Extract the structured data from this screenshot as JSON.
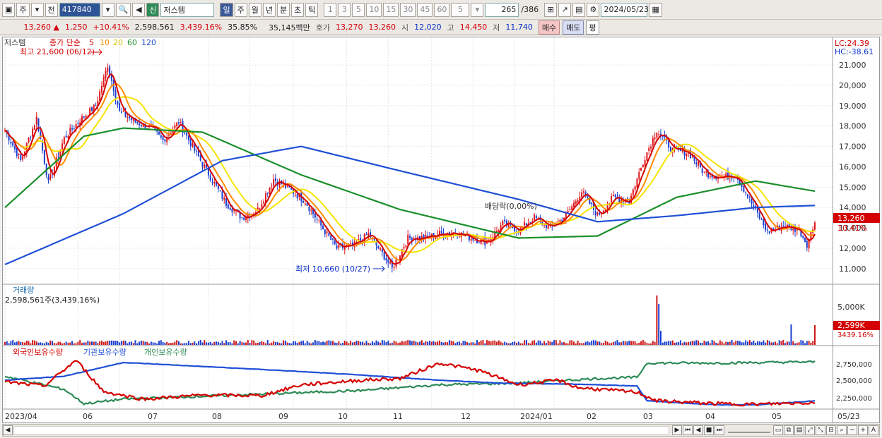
{
  "toolbar": {
    "period_main": "주",
    "prev_label": "전",
    "code": "417840",
    "name": "저스템",
    "credit_label": "신",
    "period_tabs": [
      "일",
      "주",
      "월",
      "년",
      "분",
      "초",
      "틱"
    ],
    "active_tab": 0,
    "intervals": [
      "1",
      "3",
      "5",
      "10",
      "15",
      "30",
      "45",
      "60"
    ],
    "interval_select": "5",
    "page_count": "265",
    "page_total": "/386",
    "date": "2024/05/23"
  },
  "quote": {
    "price": "13,260",
    "change": "1,250",
    "change_pct": "+10.41%",
    "volume": "2,598,561",
    "volume_ratio": "3,439.16%",
    "turnover": "35.85%",
    "amount": "35,145백만",
    "ask_label": "호가",
    "ask": "13,270",
    "bid": "13,260",
    "open_label": "시",
    "open": "12,020",
    "high_label": "고",
    "high": "14,450",
    "low_label": "저",
    "low": "11,740",
    "buy_label": "매수",
    "sell_label": "매도",
    "avg_label": "평"
  },
  "price_panel": {
    "legend_name": "저스템",
    "legend_ma": "종가 단순",
    "ma_labels": [
      "5",
      "10",
      "20",
      "60",
      "120"
    ],
    "ma_colors": [
      "#d40000",
      "#ff8c00",
      "#f5e400",
      "#1a8f2a",
      "#1f4fd6"
    ],
    "high_annot": "최고 21,600 (06/12)",
    "low_annot": "최저 10,660 (10/27)",
    "dividend_annot": "배당락(0.00%)",
    "lc": "LC:24.39",
    "hc": "HC:-38.61",
    "current_price": "13,260",
    "current_pct": "10.41%",
    "y_ticks": [
      "21,000",
      "20,000",
      "19,000",
      "18,000",
      "17,000",
      "16,000",
      "15,000",
      "14,000",
      "13,000",
      "12,000",
      "11,000"
    ]
  },
  "volume_panel": {
    "title": "거래량",
    "value": "2,598,561주(3,439.16%)",
    "y_tick": "5,000K",
    "current": "2,599K",
    "current_pct": "3439.16%"
  },
  "holding_panel": {
    "legend": [
      "외국인보유수량",
      "기관보유수량",
      "개인보유수량"
    ],
    "legend_colors": [
      "#d40000",
      "#1f4fd6",
      "#2e8b57"
    ],
    "y_ticks": [
      "2,750,000",
      "2,500,000",
      "2,250,000"
    ]
  },
  "x_axis": [
    "2023/04",
    "06",
    "07",
    "08",
    "09",
    "10",
    "11",
    "12",
    "2024/01",
    "02",
    "03",
    "04",
    "05"
  ],
  "x_axis_end": "05/23",
  "chart_data": {
    "type": "candlestick",
    "ylim": [
      10300,
      21800
    ],
    "months": [
      "2023/04",
      "06",
      "07",
      "08",
      "09",
      "10",
      "11",
      "12",
      "2024/01",
      "02",
      "03",
      "04",
      "05"
    ],
    "close_path": [
      [
        0,
        17800
      ],
      [
        8,
        16300
      ],
      [
        16,
        18400
      ],
      [
        22,
        15200
      ],
      [
        30,
        17400
      ],
      [
        38,
        18300
      ],
      [
        46,
        19000
      ],
      [
        52,
        21000
      ],
      [
        58,
        18700
      ],
      [
        66,
        18200
      ],
      [
        74,
        17900
      ],
      [
        80,
        17300
      ],
      [
        88,
        18200
      ],
      [
        96,
        16800
      ],
      [
        104,
        15500
      ],
      [
        112,
        14200
      ],
      [
        120,
        13500
      ],
      [
        128,
        13900
      ],
      [
        136,
        15400
      ],
      [
        144,
        14900
      ],
      [
        152,
        14300
      ],
      [
        160,
        13100
      ],
      [
        168,
        12000
      ],
      [
        176,
        12100
      ],
      [
        184,
        12700
      ],
      [
        192,
        11600
      ],
      [
        196,
        11000
      ],
      [
        204,
        12500
      ],
      [
        212,
        12500
      ],
      [
        220,
        12700
      ],
      [
        228,
        12800
      ],
      [
        236,
        12500
      ],
      [
        244,
        12300
      ],
      [
        252,
        13200
      ],
      [
        260,
        12900
      ],
      [
        268,
        13500
      ],
      [
        276,
        13000
      ],
      [
        284,
        13600
      ],
      [
        292,
        14800
      ],
      [
        300,
        13600
      ],
      [
        308,
        14500
      ],
      [
        316,
        14300
      ],
      [
        324,
        16500
      ],
      [
        330,
        17800
      ],
      [
        338,
        16800
      ],
      [
        346,
        16700
      ],
      [
        354,
        15700
      ],
      [
        362,
        15500
      ],
      [
        370,
        15600
      ],
      [
        378,
        14200
      ],
      [
        386,
        12800
      ],
      [
        394,
        13100
      ],
      [
        402,
        12900
      ],
      [
        406,
        12200
      ],
      [
        410,
        13260
      ]
    ],
    "ma120_path": [
      [
        0,
        11200
      ],
      [
        60,
        13700
      ],
      [
        110,
        16300
      ],
      [
        150,
        17000
      ],
      [
        200,
        15800
      ],
      [
        260,
        14400
      ],
      [
        300,
        13300
      ],
      [
        340,
        13600
      ],
      [
        380,
        14000
      ],
      [
        410,
        14100
      ]
    ],
    "ma60_path": [
      [
        0,
        14000
      ],
      [
        40,
        17500
      ],
      [
        60,
        17900
      ],
      [
        100,
        17700
      ],
      [
        150,
        15600
      ],
      [
        200,
        13900
      ],
      [
        260,
        12500
      ],
      [
        300,
        12600
      ],
      [
        340,
        14500
      ],
      [
        380,
        15300
      ],
      [
        410,
        14800
      ]
    ],
    "foreign_path": [
      [
        0,
        2500000
      ],
      [
        20,
        2430000
      ],
      [
        36,
        2880000
      ],
      [
        50,
        2330000
      ],
      [
        70,
        2200000
      ],
      [
        100,
        2270000
      ],
      [
        130,
        2260000
      ],
      [
        150,
        2450000
      ],
      [
        180,
        2530000
      ],
      [
        200,
        2560000
      ],
      [
        220,
        2830000
      ],
      [
        240,
        2700000
      ],
      [
        260,
        2450000
      ],
      [
        280,
        2530000
      ],
      [
        290,
        2400000
      ],
      [
        320,
        2320000
      ],
      [
        330,
        2170000
      ],
      [
        360,
        2120000
      ],
      [
        380,
        2110000
      ],
      [
        410,
        2140000
      ]
    ],
    "inst_path": [
      [
        0,
        2530000
      ],
      [
        30,
        2600000
      ],
      [
        60,
        2840000
      ],
      [
        100,
        2770000
      ],
      [
        140,
        2700000
      ],
      [
        180,
        2620000
      ],
      [
        220,
        2530000
      ],
      [
        250,
        2480000
      ],
      [
        290,
        2460000
      ],
      [
        320,
        2430000
      ],
      [
        325,
        2170000
      ],
      [
        360,
        2100000
      ],
      [
        380,
        2100000
      ],
      [
        410,
        2170000
      ]
    ],
    "indiv_path": [
      [
        0,
        2600000
      ],
      [
        30,
        2370000
      ],
      [
        40,
        2120000
      ],
      [
        60,
        2200000
      ],
      [
        100,
        2250000
      ],
      [
        140,
        2300000
      ],
      [
        180,
        2350000
      ],
      [
        220,
        2450000
      ],
      [
        260,
        2480000
      ],
      [
        300,
        2560000
      ],
      [
        320,
        2580000
      ],
      [
        325,
        2830000
      ],
      [
        360,
        2830000
      ],
      [
        410,
        2850000
      ]
    ],
    "holding_ylim": [
      2050000,
      2950000
    ]
  }
}
